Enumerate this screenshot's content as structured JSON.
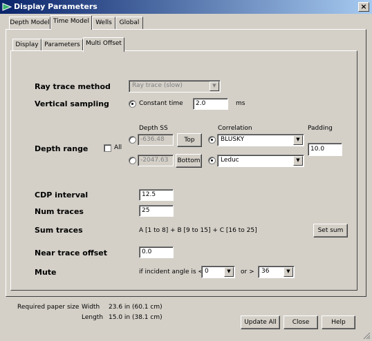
{
  "window": {
    "title": "Display Parameters",
    "close_glyph": "×"
  },
  "top_tabs": [
    "Depth Model",
    "Time Model",
    "Wells",
    "Global"
  ],
  "sub_tabs": [
    "Display",
    "Parameters",
    "Multi Offset"
  ],
  "ray_trace": {
    "label": "Ray trace method",
    "value": "Ray trace (slow)"
  },
  "vertical_sampling": {
    "label": "Vertical sampling",
    "option_label": "Constant time",
    "value": "2.0",
    "unit": "ms"
  },
  "depth_range": {
    "label": "Depth range",
    "all_label": "All",
    "depth_ss_header": "Depth SS",
    "correlation_header": "Correlation",
    "padding_header": "Padding",
    "top_value": "-636.48",
    "top_button": "Top",
    "bottom_value": "-2047.63",
    "bottom_button": "Bottom",
    "top_correlation": "BLUSKY",
    "bottom_correlation": "Leduc",
    "padding_value": "10.0"
  },
  "cdp_interval": {
    "label": "CDP interval",
    "value": "12.5"
  },
  "num_traces": {
    "label": "Num traces",
    "value": "25"
  },
  "sum_traces": {
    "label": "Sum traces",
    "formula": "A [1 to 8] + B [9 to 15] + C [16 to 25]",
    "button": "Set sum"
  },
  "near_trace_offset": {
    "label": "Near trace offset",
    "value": "0.0"
  },
  "mute": {
    "label": "Mute",
    "condition": "if incident angle is <",
    "lt_value": "0",
    "or_text": "or >",
    "gt_value": "36"
  },
  "paper": {
    "label": "Required paper size",
    "width_label": "Width",
    "width_value": "23.6 in (60.1 cm)",
    "length_label": "Length",
    "length_value": "15.0 in (38.1 cm)"
  },
  "buttons": {
    "update_all": "Update All",
    "close": "Close",
    "help": "Help"
  },
  "colors": {
    "titlebar_start": "#0a246a",
    "titlebar_end": "#a6caf0",
    "face": "#d4d0c8"
  }
}
